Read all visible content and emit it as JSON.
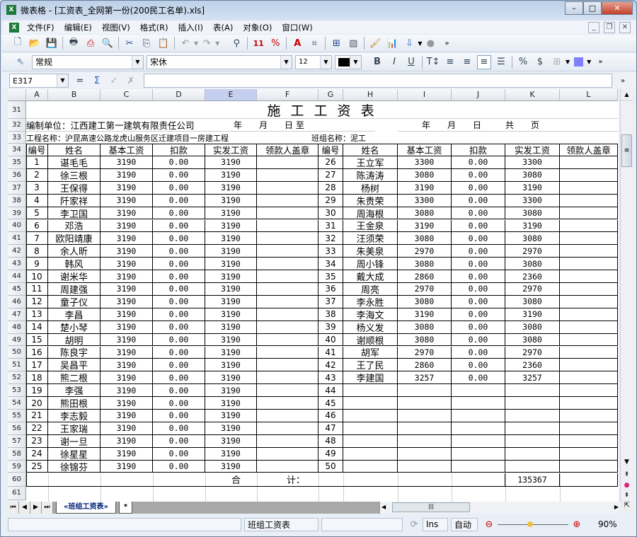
{
  "window": {
    "title": "微表格 - [工资表_全网第一份(200民工名单).xls]",
    "app_icon": "X"
  },
  "menu": [
    "文件(F)",
    "编辑(E)",
    "视图(V)",
    "格式(R)",
    "插入(I)",
    "表(A)",
    "对象(O)",
    "窗口(W)"
  ],
  "format": {
    "number_format": "常规",
    "font": "宋休",
    "size": "12"
  },
  "formula": {
    "cell_ref": "E317",
    "value": ""
  },
  "columns": [
    "A",
    "B",
    "C",
    "D",
    "E",
    "F",
    "G",
    "H",
    "I",
    "J",
    "K",
    "L"
  ],
  "rows": [
    "31",
    "32",
    "33",
    "34",
    "35",
    "36",
    "37",
    "38",
    "39",
    "40",
    "41",
    "42",
    "43",
    "44",
    "45",
    "46",
    "47",
    "48",
    "49",
    "50",
    "51",
    "52",
    "53",
    "54",
    "55",
    "56",
    "57",
    "58",
    "59",
    "60",
    "61"
  ],
  "sheet": {
    "title": "施 工 工 资 表",
    "unit_label": "编制单位：江西建工第一建筑有限责任公司",
    "date_from": "年　　月　　日 至",
    "date_to": "年　　月　　日",
    "pages": "共　　页",
    "project": "工程名称：沪昆高速公路龙虎山服务区迁建项目一房建工程",
    "team": "班组名称：泥工",
    "headers": [
      "编号",
      "姓名",
      "基本工资",
      "扣款",
      "实发工资",
      "领款人盖章"
    ],
    "left": [
      [
        "1",
        "谌毛毛",
        "3190",
        "0.00",
        "3190"
      ],
      [
        "2",
        "徐三根",
        "3190",
        "0.00",
        "3190"
      ],
      [
        "3",
        "王保得",
        "3190",
        "0.00",
        "3190"
      ],
      [
        "4",
        "阡家祥",
        "3190",
        "0.00",
        "3190"
      ],
      [
        "5",
        "李卫国",
        "3190",
        "0.00",
        "3190"
      ],
      [
        "6",
        "邓浩",
        "3190",
        "0.00",
        "3190"
      ],
      [
        "7",
        "欧阳靖康",
        "3190",
        "0.00",
        "3190"
      ],
      [
        "8",
        "余人昕",
        "3190",
        "0.00",
        "3190"
      ],
      [
        "9",
        "韩风",
        "3190",
        "0.00",
        "3190"
      ],
      [
        "10",
        "谢米华",
        "3190",
        "0.00",
        "3190"
      ],
      [
        "11",
        "周建强",
        "3190",
        "0.00",
        "3190"
      ],
      [
        "12",
        "童子仪",
        "3190",
        "0.00",
        "3190"
      ],
      [
        "13",
        "李昌",
        "3190",
        "0.00",
        "3190"
      ],
      [
        "14",
        "楚小琴",
        "3190",
        "0.00",
        "3190"
      ],
      [
        "15",
        "胡明",
        "3190",
        "0.00",
        "3190"
      ],
      [
        "16",
        "陈良宇",
        "3190",
        "0.00",
        "3190"
      ],
      [
        "17",
        "吴昌平",
        "3190",
        "0.00",
        "3190"
      ],
      [
        "18",
        "熊二根",
        "3190",
        "0.00",
        "3190"
      ],
      [
        "19",
        "李强",
        "3190",
        "0.00",
        "3190"
      ],
      [
        "20",
        "熊田根",
        "3190",
        "0.00",
        "3190"
      ],
      [
        "21",
        "李志毅",
        "3190",
        "0.00",
        "3190"
      ],
      [
        "22",
        "王家瑞",
        "3190",
        "0.00",
        "3190"
      ],
      [
        "23",
        "谢一旦",
        "3190",
        "0.00",
        "3190"
      ],
      [
        "24",
        "徐星星",
        "3190",
        "0.00",
        "3190"
      ],
      [
        "25",
        "徐锦芬",
        "3190",
        "0.00",
        "3190"
      ]
    ],
    "right": [
      [
        "26",
        "王立军",
        "3300",
        "0.00",
        "3300"
      ],
      [
        "27",
        "陈涛涛",
        "3080",
        "0.00",
        "3080"
      ],
      [
        "28",
        "杨树",
        "3190",
        "0.00",
        "3190"
      ],
      [
        "29",
        "朱贵荣",
        "3300",
        "0.00",
        "3300"
      ],
      [
        "30",
        "周海根",
        "3080",
        "0.00",
        "3080"
      ],
      [
        "31",
        "王金泉",
        "3190",
        "0.00",
        "3190"
      ],
      [
        "32",
        "汪须荣",
        "3080",
        "0.00",
        "3080"
      ],
      [
        "33",
        "朱美泉",
        "2970",
        "0.00",
        "2970"
      ],
      [
        "34",
        "周小锋",
        "3080",
        "0.00",
        "3080"
      ],
      [
        "35",
        "戴大成",
        "2860",
        "0.00",
        "2360"
      ],
      [
        "36",
        "周亮",
        "2970",
        "0.00",
        "2970"
      ],
      [
        "37",
        "李永胜",
        "3080",
        "0.00",
        "3080"
      ],
      [
        "38",
        "李海文",
        "3190",
        "0.00",
        "3190"
      ],
      [
        "39",
        "杨义发",
        "3080",
        "0.00",
        "3080"
      ],
      [
        "40",
        "谢顺根",
        "3080",
        "0.00",
        "3080"
      ],
      [
        "41",
        "胡军",
        "2970",
        "0.00",
        "2970"
      ],
      [
        "42",
        "王了民",
        "2860",
        "0.00",
        "2360"
      ],
      [
        "43",
        "李建国",
        "3257",
        "0.00",
        "3257"
      ],
      [
        "44",
        "",
        "",
        "",
        ""
      ],
      [
        "45",
        "",
        "",
        "",
        ""
      ],
      [
        "46",
        "",
        "",
        "",
        ""
      ],
      [
        "47",
        "",
        "",
        "",
        ""
      ],
      [
        "48",
        "",
        "",
        "",
        ""
      ],
      [
        "49",
        "",
        "",
        "",
        ""
      ],
      [
        "50",
        "",
        "",
        "",
        ""
      ]
    ],
    "total_label": "合　　　　　计：",
    "total_value": "135367"
  },
  "tabs": {
    "active": "«班组工资表»",
    "add": "*"
  },
  "status": {
    "sheet_name": "班组工资表",
    "ins": "Ins",
    "calc": "自动",
    "zoom": "90%"
  }
}
